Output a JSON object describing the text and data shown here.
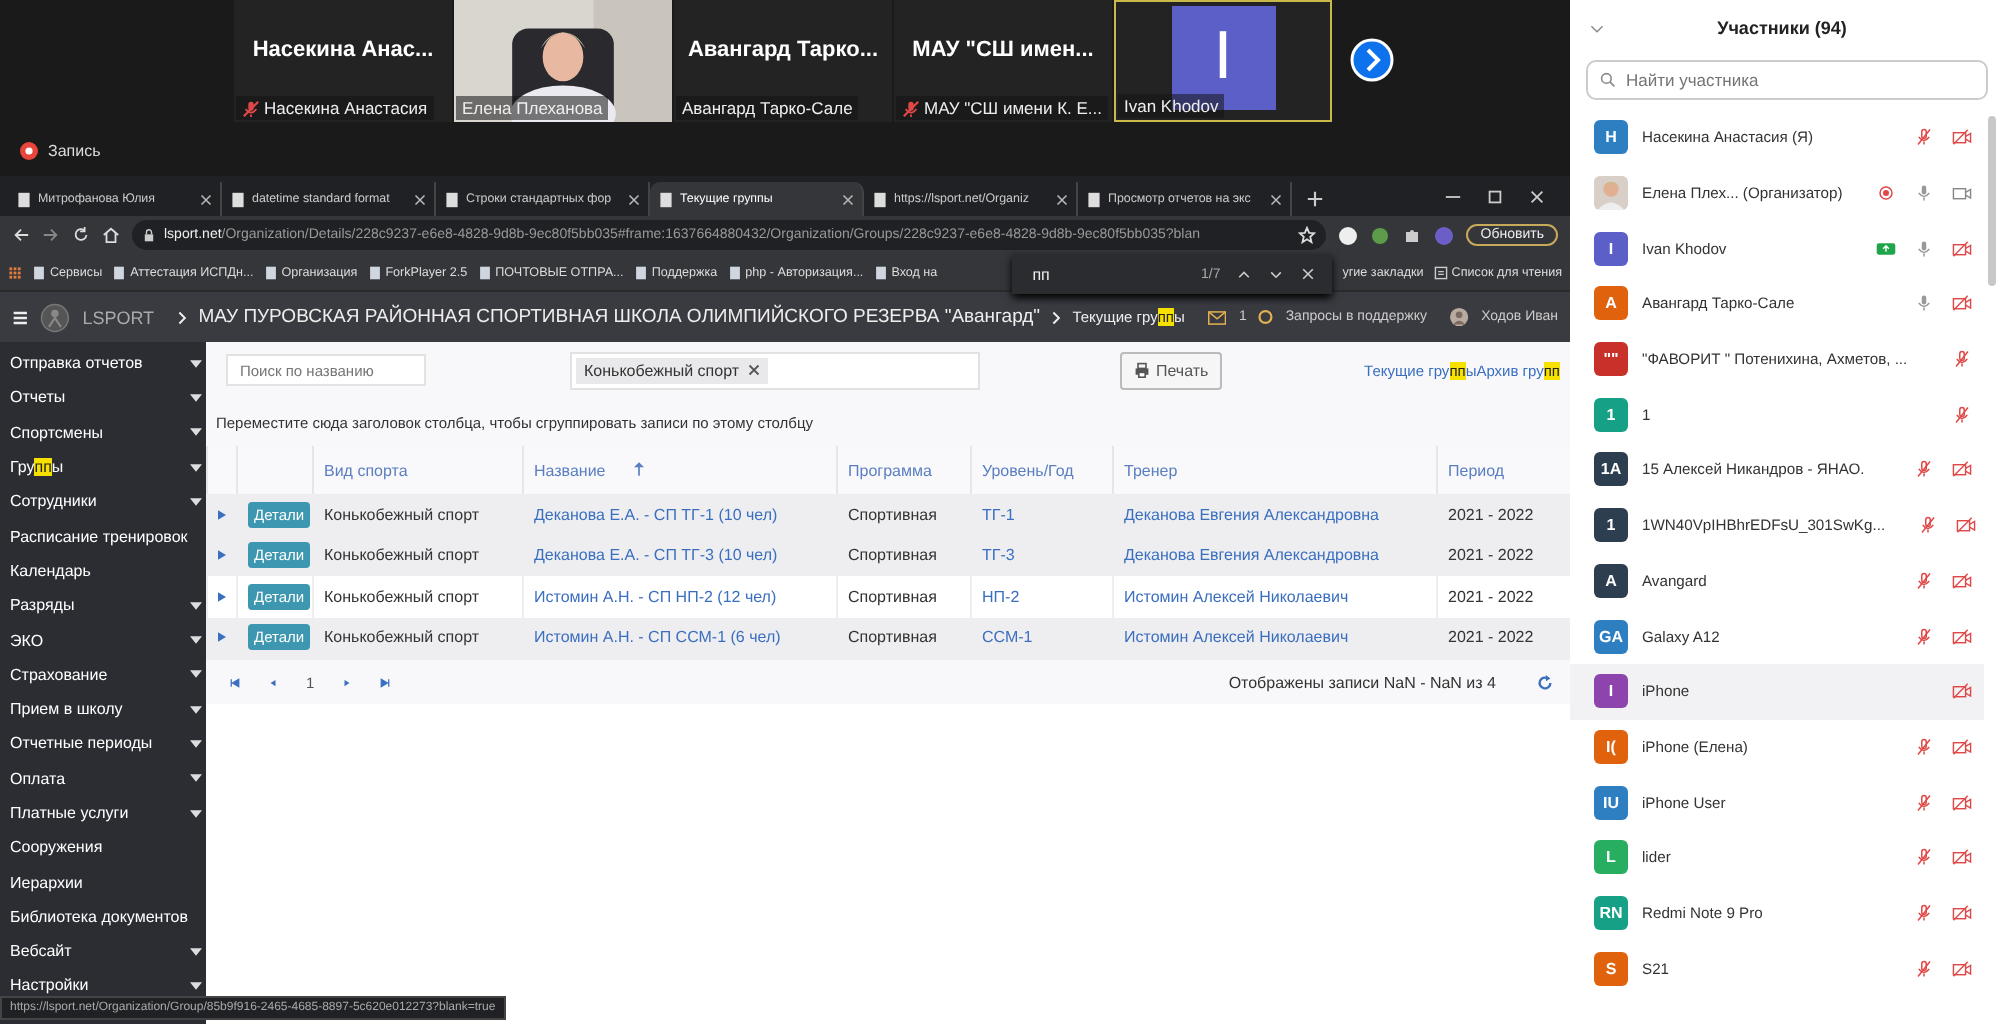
{
  "video_strip": {
    "tiles": [
      {
        "kind": "name",
        "big_name": "Насекина  Анас...",
        "label": "Насекина Анастасия",
        "muted": true,
        "speaking": false
      },
      {
        "kind": "picture",
        "label": "Елена Плеханова",
        "muted": false,
        "speaking": false
      },
      {
        "kind": "name",
        "big_name": "Авангард  Тарко...",
        "label": "Авангард Тарко-Сале",
        "muted": false,
        "speaking": false
      },
      {
        "kind": "name",
        "big_name": "МАУ  \"СШ  имен...",
        "label": "МАУ \"СШ имени К. Е...",
        "muted": true,
        "speaking": false
      },
      {
        "kind": "avatar",
        "letter": "I",
        "color": "#5b5fc7",
        "label": "Ivan Khodov",
        "muted": false,
        "speaking": true
      }
    ]
  },
  "recording": {
    "label": "Запись"
  },
  "browser": {
    "tabs": [
      {
        "title": "Митрофанова Юлия",
        "selected": false
      },
      {
        "title": "datetime standard format",
        "selected": false
      },
      {
        "title": "Строки стандартных фор",
        "selected": false
      },
      {
        "title": "Текущие группы",
        "selected": true
      },
      {
        "title": "https://lsport.net/Organiz",
        "selected": false
      },
      {
        "title": "Просмотр отчетов на экс",
        "selected": false
      }
    ],
    "address": {
      "host": "lsport.net",
      "path": "/Organization/Details/228c9237-e6e8-4828-9d8b-9ec80f5bb035#frame:1637664880432/Organization/Groups/228c9237-e6e8-4828-9d8b-9ec80f5bb035?blan"
    },
    "update_button": "Обновить",
    "bookmarks": [
      "Сервисы",
      "Аттестация ИСПДн...",
      "Организация",
      "ForkPlayer 2.5",
      "ПОЧТОВЫЕ ОТПРА...",
      "Поддержка",
      "php - Авторизация...",
      "Вход на"
    ],
    "bookmarks_right": [
      "угие закладки",
      "Список для чтения"
    ],
    "find_bar": {
      "value": "пп",
      "count": "1/7"
    },
    "status_url": "https://lsport.net/Organization/Group/85b9f916-2465-4685-8897-5c620e012273?blank=true"
  },
  "site": {
    "logo": "LSPORT",
    "org_title": "МАУ ПУРОВСКАЯ РАЙОННАЯ СПОРТИВНАЯ ШКОЛА ОЛИМПИЙСКОГО РЕЗЕРВА \"Авангард\"",
    "breadcrumb": [
      {
        "text": "Текущие гру",
        "highlight": false
      },
      {
        "text": "пп",
        "highlight": true
      },
      {
        "text": "ы",
        "highlight": false
      }
    ],
    "mail_count": "1",
    "support": "Запросы в поддержку",
    "user": "Ходов Иван",
    "sidebar": [
      {
        "parts": [
          {
            "text": "Отправка отчетов",
            "highlight": false
          }
        ],
        "has_submenu": true
      },
      {
        "parts": [
          {
            "text": "Отчеты",
            "highlight": false
          }
        ],
        "has_submenu": true
      },
      {
        "parts": [
          {
            "text": "Спортсмены",
            "highlight": false
          }
        ],
        "has_submenu": true
      },
      {
        "parts": [
          {
            "text": "Гру",
            "highlight": false
          },
          {
            "text": "пп",
            "highlight": true
          },
          {
            "text": "ы",
            "highlight": false
          }
        ],
        "has_submenu": true
      },
      {
        "parts": [
          {
            "text": "Сотрудники",
            "highlight": false
          }
        ],
        "has_submenu": true
      },
      {
        "parts": [
          {
            "text": "Расписание тренировок",
            "highlight": false
          }
        ],
        "has_submenu": false
      },
      {
        "parts": [
          {
            "text": "Календарь",
            "highlight": false
          }
        ],
        "has_submenu": false
      },
      {
        "parts": [
          {
            "text": "Разряды",
            "highlight": false
          }
        ],
        "has_submenu": true
      },
      {
        "parts": [
          {
            "text": "ЭКО",
            "highlight": false
          }
        ],
        "has_submenu": true
      },
      {
        "parts": [
          {
            "text": "Страхование",
            "highlight": false
          }
        ],
        "has_submenu": true
      },
      {
        "parts": [
          {
            "text": "Прием в школу",
            "highlight": false
          }
        ],
        "has_submenu": true
      },
      {
        "parts": [
          {
            "text": "Отчетные периоды",
            "highlight": false
          }
        ],
        "has_submenu": true
      },
      {
        "parts": [
          {
            "text": "Оплата",
            "highlight": false
          }
        ],
        "has_submenu": true
      },
      {
        "parts": [
          {
            "text": "Платные услуги",
            "highlight": false
          }
        ],
        "has_submenu": true
      },
      {
        "parts": [
          {
            "text": "Сооружения",
            "highlight": false
          }
        ],
        "has_submenu": false
      },
      {
        "parts": [
          {
            "text": "Иерархии",
            "highlight": false
          }
        ],
        "has_submenu": false
      },
      {
        "parts": [
          {
            "text": "Библиотека документов",
            "highlight": false
          }
        ],
        "has_submenu": false
      },
      {
        "parts": [
          {
            "text": "Вебсайт",
            "highlight": false
          }
        ],
        "has_submenu": true
      },
      {
        "parts": [
          {
            "text": "Настройки",
            "highlight": false
          }
        ],
        "has_submenu": true
      }
    ],
    "search": {
      "placeholder": "Поиск по названию"
    },
    "filter_chip": "Конькобежный спорт",
    "print_button": "Печать",
    "links": [
      [
        {
          "text": "Текущие гру",
          "highlight": false
        },
        {
          "text": "пп",
          "highlight": true
        },
        {
          "text": "ы",
          "highlight": false
        }
      ],
      [
        {
          "text": "Архив гру",
          "highlight": false
        },
        {
          "text": "пп",
          "highlight": true
        }
      ]
    ],
    "group_hint": "Переместите сюда заголовок столбца, чтобы сгруппировать записи по этому столбцу",
    "table": {
      "columns": [
        {
          "label": "Вид спорта",
          "sorted": false
        },
        {
          "label": "Название",
          "sorted": true
        },
        {
          "label": "Программа",
          "sorted": false
        },
        {
          "label": "Уровень/Год",
          "sorted": false
        },
        {
          "label": "Тренер",
          "sorted": false
        },
        {
          "label": "Период",
          "sorted": false
        }
      ],
      "rows": [
        {
          "action": "Детали",
          "sport": "Конькобежный спорт",
          "name": "Деканова Е.А. - СП ТГ-1 (10 чел)",
          "program": "Спортивная",
          "level": "ТГ-1",
          "coach": "Деканова Евгения Александровна",
          "period": "2021 - 2022",
          "shaded": true
        },
        {
          "action": "Детали",
          "sport": "Конькобежный спорт",
          "name": "Деканова Е.А. - СП ТГ-3 (10 чел)",
          "program": "Спортивная",
          "level": "ТГ-3",
          "coach": "Деканова Евгения Александровна",
          "period": "2021 - 2022",
          "shaded": true
        },
        {
          "action": "Детали",
          "sport": "Конькобежный спорт",
          "name": "Истомин А.Н. - СП НП-2 (12 чел)",
          "program": "Спортивная",
          "level": "НП-2",
          "coach": "Истомин Алексей Николаевич",
          "period": "2021 - 2022",
          "shaded": false
        },
        {
          "action": "Детали",
          "sport": "Конькобежный спорт",
          "name": "Истомин А.Н. - СП ССМ-1 (6 чел)",
          "program": "Спортивная",
          "level": "ССМ-1",
          "coach": "Истомин Алексей Николаевич",
          "period": "2021 - 2022",
          "shaded": true
        }
      ],
      "page": "1",
      "records": "Отображены записи NaN - NaN из 4"
    }
  },
  "participants": {
    "title": "Участники (94)",
    "search": {
      "placeholder": "Найти участника"
    },
    "list": [
      {
        "avatar": {
          "kind": "letters",
          "letters": "Н",
          "color": "#2d7fc1"
        },
        "name": "Насекина Анастасия (Я)",
        "highlighted": false,
        "indicators": [
          {
            "kind": "mic_off"
          },
          {
            "kind": "video_off"
          }
        ]
      },
      {
        "avatar": {
          "kind": "picture"
        },
        "name": "Елена Плех...  (Организатор)",
        "highlighted": false,
        "indicators": [
          {
            "kind": "recording"
          },
          {
            "kind": "mic_on"
          },
          {
            "kind": "video_on"
          }
        ]
      },
      {
        "avatar": {
          "kind": "letters",
          "letters": "I",
          "color": "#5b5fc7"
        },
        "name": "Ivan Khodov",
        "highlighted": false,
        "indicators": [
          {
            "kind": "screen_share"
          },
          {
            "kind": "mic_on"
          },
          {
            "kind": "video_off"
          }
        ]
      },
      {
        "avatar": {
          "kind": "letters",
          "letters": "А",
          "color": "#e0620d"
        },
        "name": "Авангард Тарко-Сале",
        "highlighted": false,
        "indicators": [
          {
            "kind": "mic_on"
          },
          {
            "kind": "video_off"
          }
        ]
      },
      {
        "avatar": {
          "kind": "letters",
          "letters": "\"\"",
          "color": "#c8302a"
        },
        "name": "\"ФАВОРИТ \" Потенихина, Ахметов, ...",
        "highlighted": false,
        "indicators": [
          {
            "kind": "mic_off"
          }
        ]
      },
      {
        "avatar": {
          "kind": "letters",
          "letters": "1",
          "color": "#16a085"
        },
        "name": "1",
        "highlighted": false,
        "indicators": [
          {
            "kind": "mic_off"
          }
        ]
      },
      {
        "avatar": {
          "kind": "letters",
          "letters": "1А",
          "color": "#2c3e50"
        },
        "name": "15 Алексей Никандров - ЯНАО.",
        "highlighted": false,
        "indicators": [
          {
            "kind": "mic_off"
          },
          {
            "kind": "video_off"
          }
        ]
      },
      {
        "avatar": {
          "kind": "letters",
          "letters": "1",
          "color": "#2c3e50"
        },
        "name": "1WN40VpIHBhrEDFsU_301SwKg...",
        "highlighted": false,
        "indicators": [
          {
            "kind": "mic_off"
          },
          {
            "kind": "video_off"
          }
        ]
      },
      {
        "avatar": {
          "kind": "letters",
          "letters": "A",
          "color": "#2c3e50"
        },
        "name": "Avangard",
        "highlighted": false,
        "indicators": [
          {
            "kind": "mic_off"
          },
          {
            "kind": "video_off"
          }
        ]
      },
      {
        "avatar": {
          "kind": "letters",
          "letters": "GA",
          "color": "#2d7fc1"
        },
        "name": "Galaxy A12",
        "highlighted": false,
        "indicators": [
          {
            "kind": "mic_off"
          },
          {
            "kind": "video_off"
          }
        ]
      },
      {
        "avatar": {
          "kind": "letters",
          "letters": "I",
          "color": "#8e44ad"
        },
        "name": "iPhone",
        "highlighted": true,
        "indicators": [
          {
            "kind": "video_off"
          }
        ]
      },
      {
        "avatar": {
          "kind": "letters",
          "letters": "I(",
          "color": "#e0620d"
        },
        "name": "iPhone (Елена)",
        "highlighted": false,
        "indicators": [
          {
            "kind": "mic_off"
          },
          {
            "kind": "video_off"
          }
        ]
      },
      {
        "avatar": {
          "kind": "letters",
          "letters": "IU",
          "color": "#2d7fc1"
        },
        "name": "iPhone User",
        "highlighted": false,
        "indicators": [
          {
            "kind": "mic_off"
          },
          {
            "kind": "video_off"
          }
        ]
      },
      {
        "avatar": {
          "kind": "letters",
          "letters": "L",
          "color": "#27ae60"
        },
        "name": "lider",
        "highlighted": false,
        "indicators": [
          {
            "kind": "mic_off"
          },
          {
            "kind": "video_off"
          }
        ]
      },
      {
        "avatar": {
          "kind": "letters",
          "letters": "RN",
          "color": "#16a085"
        },
        "name": "Redmi Note 9 Pro",
        "highlighted": false,
        "indicators": [
          {
            "kind": "mic_off"
          },
          {
            "kind": "video_off"
          }
        ]
      },
      {
        "avatar": {
          "kind": "letters",
          "letters": "S",
          "color": "#e0620d"
        },
        "name": "S21",
        "highlighted": false,
        "indicators": [
          {
            "kind": "mic_off"
          },
          {
            "kind": "video_off"
          }
        ]
      }
    ]
  }
}
